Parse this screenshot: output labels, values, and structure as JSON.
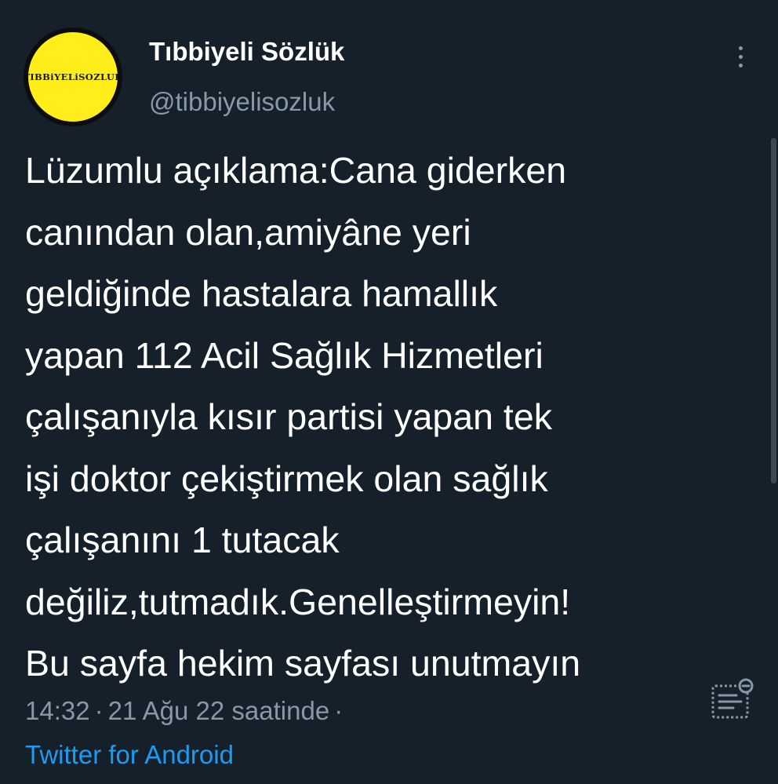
{
  "profile": {
    "display_name": "Tıbbiyeli Sözlük",
    "handle": "@tibbiyelisozluk",
    "avatar_text": "TIBBiYELiSOZLUK",
    "avatar_color": "#ffee1a"
  },
  "tweet": {
    "text_lines": [
      "Lüzumlu açıklama:Cana giderken",
      "canından olan,amiyâne yeri",
      "geldiğinde hastalara hamallık",
      "yapan 112 Acil Sağlık Hizmetleri",
      "çalışanıyla kısır partisi yapan tek",
      "işi doktor çekiştirmek olan sağlık",
      "çalışanını 1 tutacak",
      "değiliz,tutmadık.Genelleştirmeyin!",
      "Bu sayfa hekim sayfası unutmayın"
    ],
    "time": "14:32",
    "date": "21 Ağu 22 saatinde",
    "separator": "·",
    "source": "Twitter for Android"
  },
  "icons": {
    "more": "more-vertical-icon",
    "analytics": "analytics-icon"
  },
  "colors": {
    "background": "#15202b",
    "primary_text": "#ffffff",
    "secondary_text": "#8899a6",
    "link": "#1d9bf0"
  }
}
